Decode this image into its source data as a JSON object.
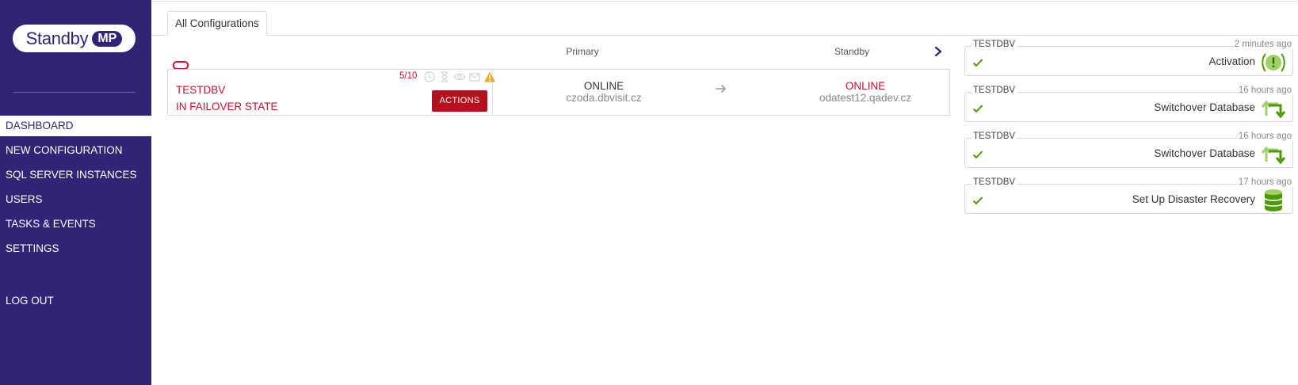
{
  "logo": {
    "text": "Standby",
    "badge": "MP"
  },
  "nav": {
    "items": [
      {
        "label": "DASHBOARD",
        "active": true
      },
      {
        "label": "NEW CONFIGURATION"
      },
      {
        "label": "SQL SERVER INSTANCES"
      },
      {
        "label": "USERS"
      },
      {
        "label": "TASKS & EVENTS"
      },
      {
        "label": "SETTINGS"
      }
    ],
    "logout": "LOG OUT"
  },
  "tabs": [
    {
      "label": "All Configurations"
    }
  ],
  "columns": {
    "primary": "Primary",
    "standby": "Standby"
  },
  "configuration": {
    "name": "TESTDBV",
    "state": "IN FAILOVER STATE",
    "count": "5/10",
    "actions_label": "ACTIONS",
    "primary": {
      "status": "ONLINE",
      "host": "czoda.dbvisit.cz"
    },
    "standby": {
      "status": "ONLINE",
      "host": "odatest12.qadev.cz"
    }
  },
  "events": [
    {
      "db": "TESTDBV",
      "time": "2 minutes ago",
      "title": "Activation",
      "icon": "activation-icon"
    },
    {
      "db": "TESTDBV",
      "time": "16 hours ago",
      "title": "Switchover Database",
      "icon": "switchover-icon"
    },
    {
      "db": "TESTDBV",
      "time": "16 hours ago",
      "title": "Switchover Database",
      "icon": "switchover-icon"
    },
    {
      "db": "TESTDBV",
      "time": "17 hours ago",
      "title": "Set Up Disaster Recovery",
      "icon": "database-icon"
    }
  ],
  "colors": {
    "brand": "#2f2475",
    "danger": "#c8102e",
    "success": "#4e9a06",
    "warning": "#f5a623"
  }
}
